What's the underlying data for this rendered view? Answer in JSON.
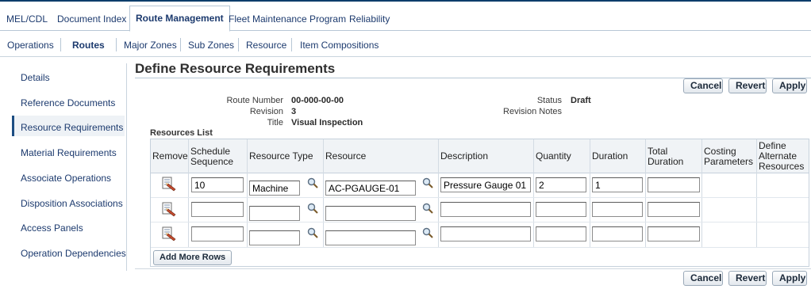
{
  "tabs": [
    {
      "label": "MEL/CDL"
    },
    {
      "label": "Document Index"
    },
    {
      "label": "Route Management"
    },
    {
      "label": "Fleet Maintenance Program"
    },
    {
      "label": "Reliability"
    }
  ],
  "subnav": [
    {
      "label": "Operations"
    },
    {
      "label": "Routes"
    },
    {
      "label": "Major Zones"
    },
    {
      "label": "Sub Zones"
    },
    {
      "label": "Resource"
    },
    {
      "label": "Item Compositions"
    }
  ],
  "sidenav": [
    {
      "label": "Details"
    },
    {
      "label": "Reference Documents"
    },
    {
      "label": "Resource Requirements"
    },
    {
      "label": "Material Requirements"
    },
    {
      "label": "Associate Operations"
    },
    {
      "label": "Disposition Associations"
    },
    {
      "label": "Access Panels"
    },
    {
      "label": "Operation Dependencies"
    }
  ],
  "page_title": "Define Resource Requirements",
  "buttons": {
    "cancel": "Cancel",
    "revert": "Revert",
    "apply": "Apply"
  },
  "header": {
    "route_number_label": "Route Number",
    "route_number": "00-000-00-00",
    "revision_label": "Revision",
    "revision": "3",
    "title_label": "Title",
    "title": "Visual Inspection",
    "status_label": "Status",
    "status": "Draft",
    "revision_notes_label": "Revision Notes"
  },
  "resources_list": {
    "heading": "Resources List",
    "columns": {
      "remove": "Remove",
      "schedule_1": "Schedule",
      "schedule_2": "Sequence",
      "resource_type": "Resource Type",
      "resource": "Resource",
      "description": "Description",
      "quantity": "Quantity",
      "duration": "Duration",
      "total_1": "Total",
      "total_2": "Duration",
      "costing_1": "Costing",
      "costing_2": "Parameters",
      "alt_1": "Define",
      "alt_2": "Alternate",
      "alt_3": "Resources"
    },
    "rows": [
      {
        "sequence": "10",
        "resource_type": "Machine",
        "resource": "AC-PGAUGE-01",
        "description": "Pressure Gauge 01",
        "quantity": "2",
        "duration": "1",
        "total_duration": ""
      },
      {
        "sequence": "",
        "resource_type": "",
        "resource": "",
        "description": "",
        "quantity": "",
        "duration": "",
        "total_duration": ""
      },
      {
        "sequence": "",
        "resource_type": "",
        "resource": "",
        "description": "",
        "quantity": "",
        "duration": "",
        "total_duration": ""
      }
    ],
    "add_more_rows": "Add More Rows"
  },
  "colors": {
    "nav_text": "#1c3a6e",
    "border": "#b7c7d6",
    "header_bg": "#f0f3f6"
  }
}
